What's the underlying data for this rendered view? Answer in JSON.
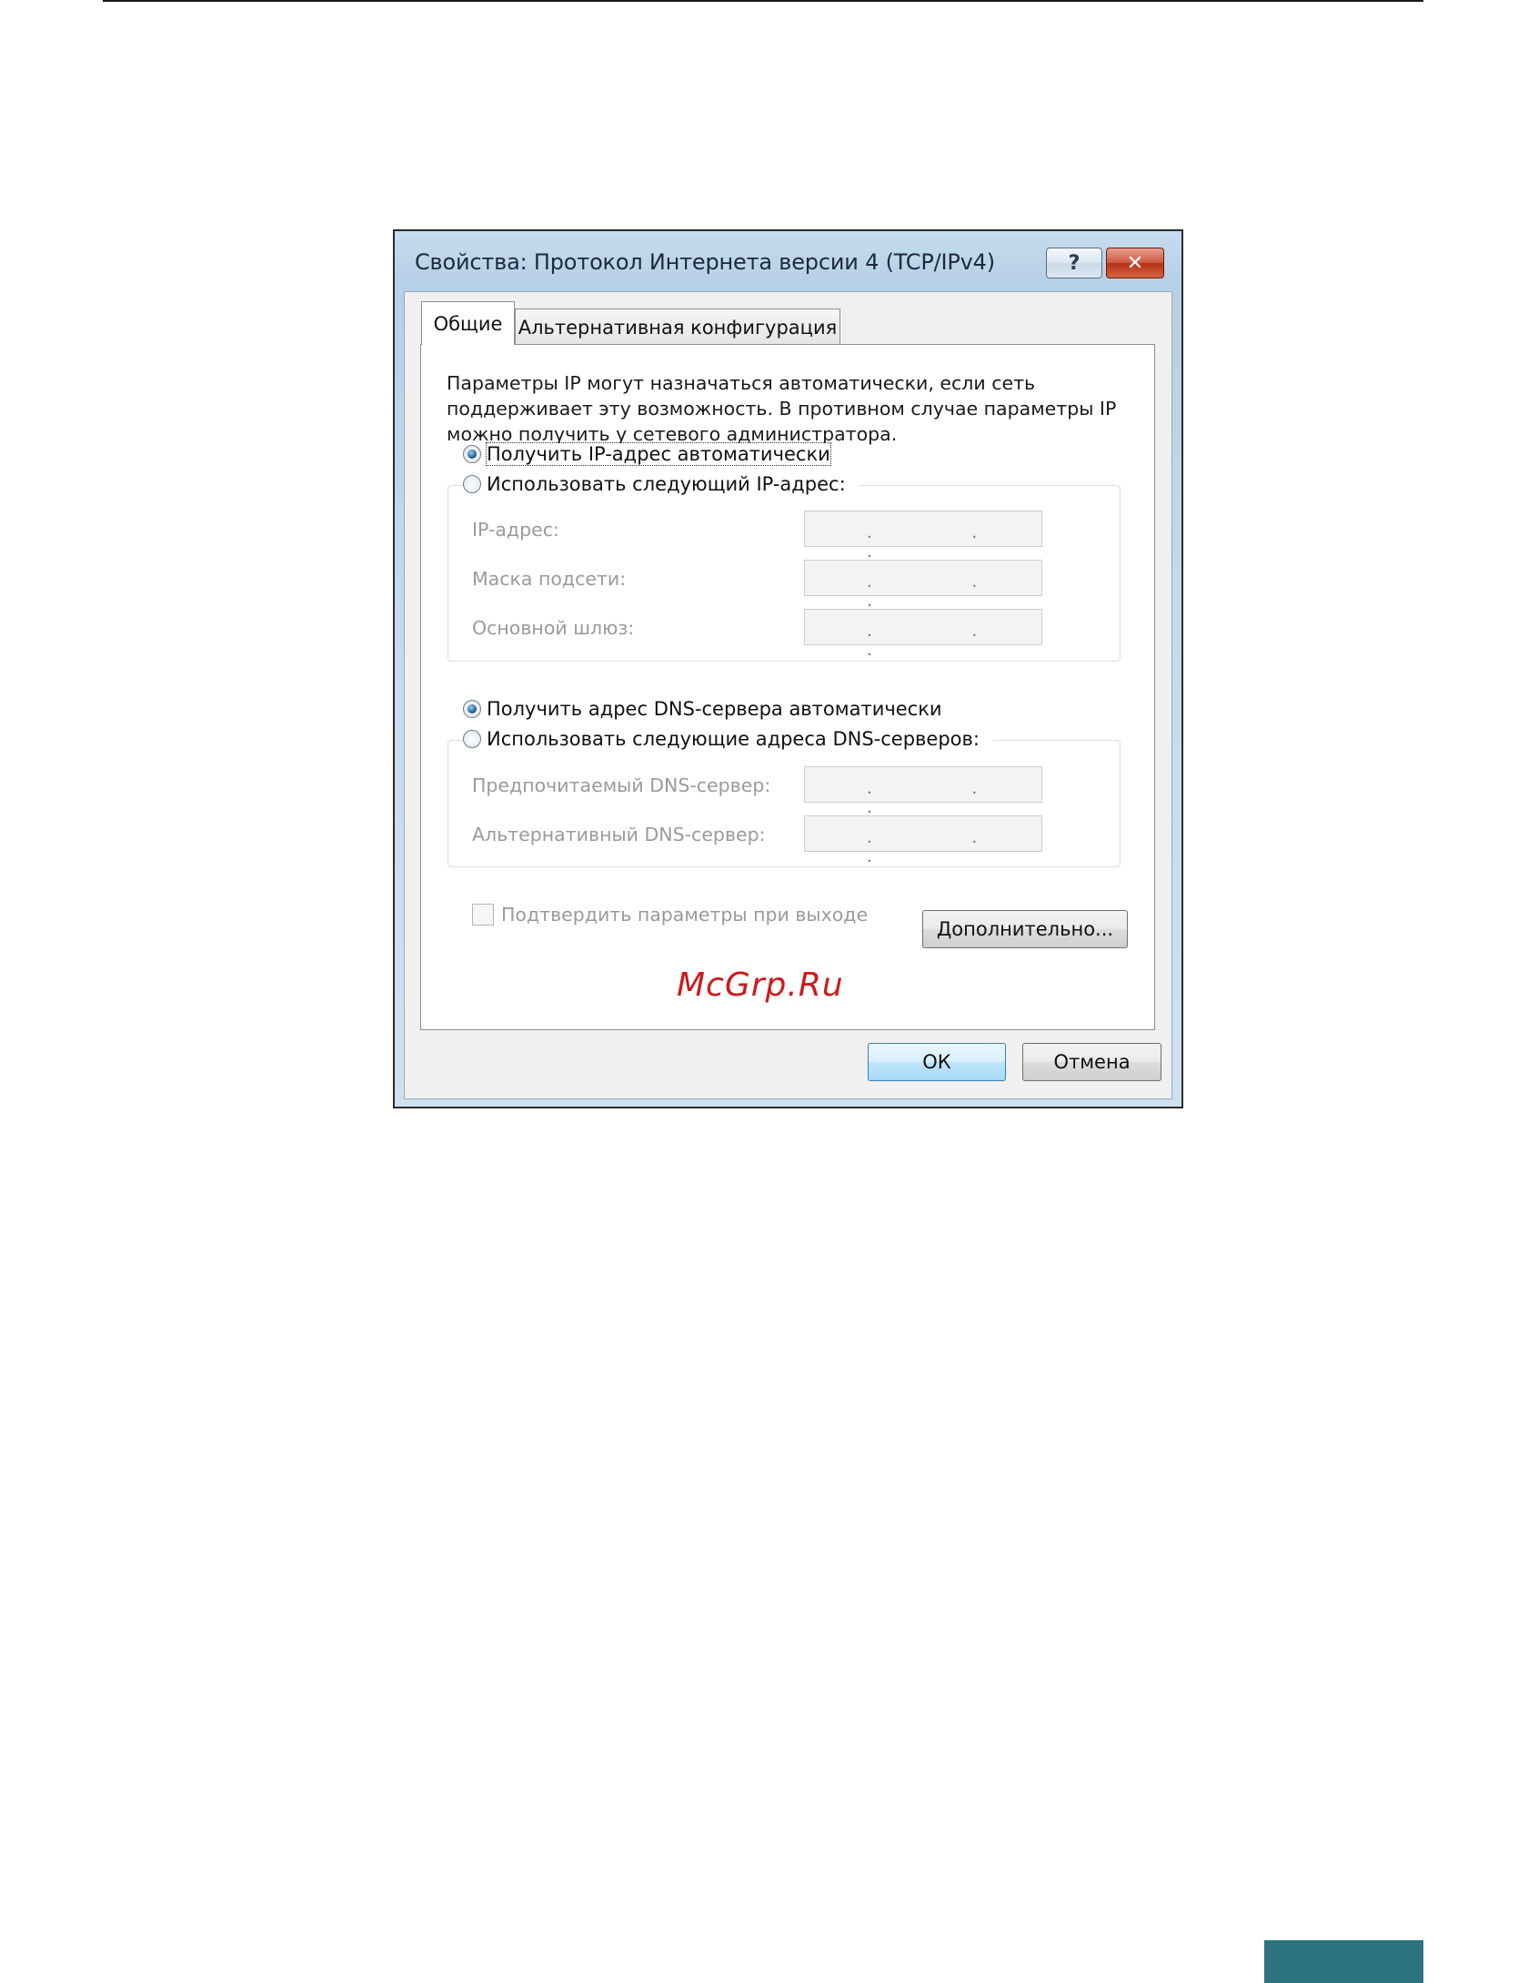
{
  "window": {
    "title": "Свойства: Протокол Интернета версии 4 (TCP/IPv4)",
    "help_glyph": "?",
    "close_glyph": "✕"
  },
  "tabs": [
    {
      "label": "Общие",
      "selected": true
    },
    {
      "label": "Альтернативная конфигурация",
      "selected": false
    }
  ],
  "description": "Параметры IP могут назначаться автоматически, если сеть поддерживает эту возможность. В противном случае параметры IP можно получить у сетевого администратора.",
  "ip_section": {
    "auto_label": "Получить IP-адрес автоматически",
    "auto_selected": true,
    "manual_label": "Использовать следующий IP-адрес:",
    "fields": [
      {
        "label": "IP-адрес:",
        "value": ". . ."
      },
      {
        "label": "Маска подсети:",
        "value": ". . ."
      },
      {
        "label": "Основной шлюз:",
        "value": ". . ."
      }
    ]
  },
  "dns_section": {
    "auto_label": "Получить адрес DNS-сервера автоматически",
    "auto_selected": true,
    "manual_label": "Использовать следующие адреса DNS-серверов:",
    "fields": [
      {
        "label": "Предпочитаемый DNS-сервер:",
        "value": ". . ."
      },
      {
        "label": "Альтернативный DNS-сервер:",
        "value": ". . ."
      }
    ]
  },
  "validate_checkbox": {
    "label": "Подтвердить параметры при выходе",
    "checked": false
  },
  "buttons": {
    "advanced": "Дополнительно...",
    "ok": "ОК",
    "cancel": "Отмена"
  },
  "watermark": "McGrp.Ru",
  "colors": {
    "accent": "#2d7280",
    "watermark": "#cc1a1a"
  }
}
